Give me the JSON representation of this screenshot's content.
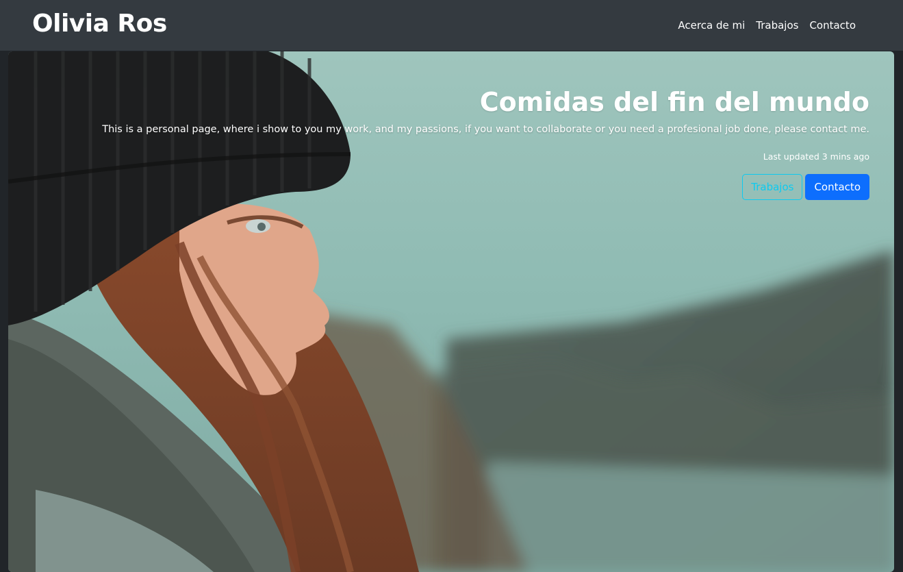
{
  "navbar": {
    "brand": "Olivia Ros",
    "links": [
      {
        "label": "Acerca de mi"
      },
      {
        "label": "Trabajos"
      },
      {
        "label": "Contacto"
      }
    ]
  },
  "hero": {
    "title": "Comidas del fin del mundo",
    "description": "This is a personal page, where i show to you my work, and my passions, if you want to collaborate or you need a profesional job done, please contact me.",
    "updated": "Last updated 3 mins ago",
    "buttons": {
      "secondary": "Trabajos",
      "primary": "Contacto"
    },
    "image": "woman-in-beanie-by-misty-cliffs-photo"
  },
  "colors": {
    "navbar_bg": "#343a40",
    "page_bg": "#212529",
    "primary": "#0d6efd",
    "info": "#0dcaf0"
  }
}
